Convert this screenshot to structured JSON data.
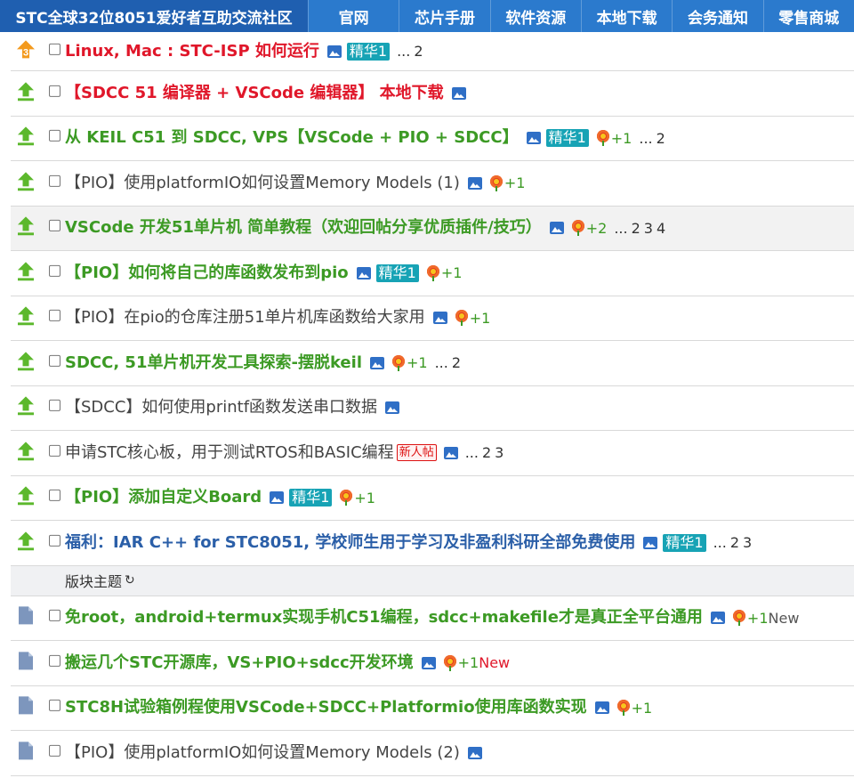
{
  "nav": {
    "brand": "STC全球32位8051爱好者互助交流社区",
    "items": [
      "官网",
      "芯片手册",
      "软件资源",
      "本地下载",
      "会务通知",
      "零售商城"
    ]
  },
  "threads": [
    {
      "icon": "hot-icon",
      "icon_label": "3",
      "title": "Linux, Mac : STC-ISP 如何运行",
      "style": "red",
      "image": true,
      "digest": "精华1",
      "pages": [
        "...",
        "2"
      ]
    },
    {
      "icon": "upvote-icon",
      "title": "【SDCC 51 编译器 + VSCode 编辑器】 本地下载",
      "style": "red",
      "image": true
    },
    {
      "icon": "upvote-icon",
      "title": "从 KEIL C51 到 SDCC, VPS【VSCode + PIO + SDCC】",
      "style": "green",
      "image": true,
      "digest": "精华1",
      "flower": "+1",
      "pages": [
        "...",
        "2"
      ]
    },
    {
      "icon": "upvote-icon",
      "title": "【PIO】使用platformIO如何设置Memory Models (1)",
      "style": "plain",
      "image": true,
      "flower": "+1"
    },
    {
      "icon": "upvote-icon",
      "title": "VSCode 开发51单片机 简单教程（欢迎回帖分享优质插件/技巧）",
      "style": "green",
      "image": true,
      "flower": "+2",
      "pages": [
        "...",
        "2",
        "3",
        "4"
      ],
      "highlight": true
    },
    {
      "icon": "upvote-icon",
      "title": "【PIO】如何将自己的库函数发布到pio",
      "style": "green",
      "image": true,
      "digest": "精华1",
      "flower": "+1"
    },
    {
      "icon": "upvote-icon",
      "title": "【PIO】在pio的仓库注册51单片机库函数给大家用",
      "style": "plain",
      "image": true,
      "flower": "+1"
    },
    {
      "icon": "upvote-icon",
      "title": "SDCC, 51单片机开发工具探索-摆脱keil",
      "style": "green",
      "image": true,
      "flower": "+1",
      "pages": [
        "...",
        "2"
      ]
    },
    {
      "icon": "upvote-icon",
      "title": "【SDCC】如何使用printf函数发送串口数据",
      "style": "plain",
      "image": true
    },
    {
      "icon": "upvote-icon",
      "title": "申请STC核心板，用于测试RTOS和BASIC编程",
      "style": "plain",
      "new_user": "新人帖",
      "image": true,
      "pages": [
        "...",
        "2",
        "3"
      ]
    },
    {
      "icon": "upvote-icon",
      "title": "【PIO】添加自定义Board",
      "style": "green",
      "image": true,
      "digest": "精华1",
      "flower": "+1"
    },
    {
      "icon": "upvote-icon",
      "title": "福利：IAR C++ for STC8051, 学校师生用于学习及非盈利科研全部免费使用",
      "style": "blue",
      "image": true,
      "digest": "精华1",
      "pages": [
        "...",
        "2",
        "3"
      ]
    }
  ],
  "separator": {
    "label": "版块主题",
    "refresh": "↻"
  },
  "topics": [
    {
      "icon": "document-icon",
      "title": "免root，android+termux实现手机C51编程，sdcc+makefile才是真正全平台通用",
      "style": "green",
      "image": true,
      "flower": "+1",
      "new": "New",
      "new_color": "gray"
    },
    {
      "icon": "document-icon",
      "title": "搬运几个STC开源库，VS+PIO+sdcc开发环境",
      "style": "green",
      "image": true,
      "flower": "+1",
      "new": "New",
      "new_color": "red"
    },
    {
      "icon": "document-icon",
      "title": "STC8H试验箱例程使用VSCode+SDCC+Platformio使用库函数实现",
      "style": "green",
      "image": true,
      "flower": "+1"
    },
    {
      "icon": "document-icon",
      "title": "【PIO】使用platformIO如何设置Memory Models (2)",
      "style": "plain",
      "image": true
    }
  ]
}
